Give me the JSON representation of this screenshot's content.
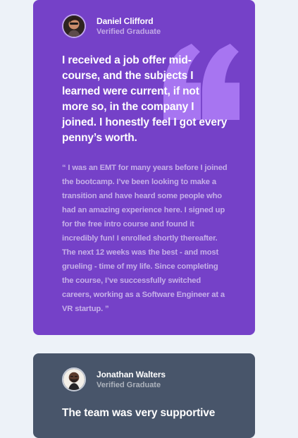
{
  "testimonials": [
    {
      "name": "Daniel Clifford",
      "role": "Verified Graduate",
      "headline": "I received a job offer mid-course, and the subjects I learned were current, if not more so, in the company I joined. I honestly feel I got every penny’s worth.",
      "quote": "“ I was an EMT for many years before I joined the bootcamp. I’ve been looking to make a transition and have heard some people who had an amazing experience here. I signed up for the free intro course and found it incredibly fun! I enrolled shortly thereafter. The next 12 weeks was the best - and most grueling - time of my life. Since completing the course, I’ve successfully switched careers, working as a Software Engineer at a VR startup. ”",
      "background": "#7541c8",
      "accent": "#a775f1",
      "icon": "quote-icon"
    },
    {
      "name": "Jonathan Walters",
      "role": "Verified Graduate",
      "headline": "The team was very supportive",
      "background": "#48556a"
    }
  ]
}
